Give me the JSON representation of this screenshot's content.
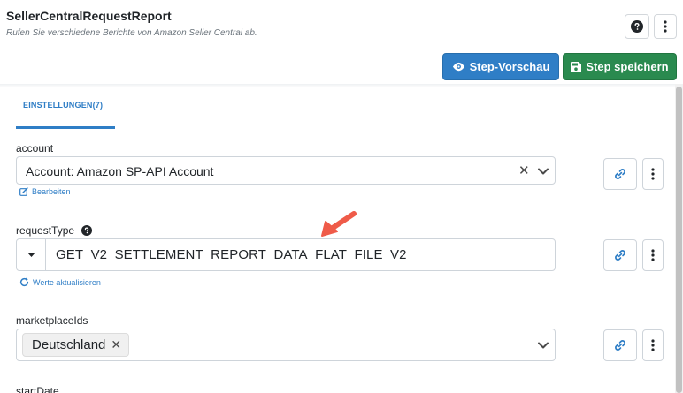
{
  "header": {
    "title": "SellerCentralRequestReport",
    "subtitle": "Rufen Sie verschiedene Berichte von Amazon Seller Central ab.",
    "preview_label": "Step-Vorschau",
    "save_label": "Step speichern",
    "preview_color": "#2f7ec6",
    "save_color": "#2a8a4f"
  },
  "tabs": [
    {
      "label": "EINSTELLUNGEN(7)",
      "active": true
    }
  ],
  "fields": {
    "account": {
      "label": "account",
      "value": "Account: Amazon SP-API Account",
      "link_label": "Bearbeiten"
    },
    "requestType": {
      "label": "requestType",
      "value": "GET_V2_SETTLEMENT_REPORT_DATA_FLAT_FILE_V2",
      "link_label": "Werte aktualisieren"
    },
    "marketplaceIds": {
      "label": "marketplaceIds",
      "chips": [
        "Deutschland"
      ]
    },
    "startDate": {
      "label": "startDate"
    }
  },
  "icons": {
    "help": "question-circle-icon",
    "menu": "vertical-ellipsis-icon",
    "preview": "eye-icon",
    "save": "floppy-disk-icon",
    "link": "link-icon",
    "edit": "edit-icon",
    "refresh": "refresh-icon",
    "annotation": "red-arrow-annotation"
  }
}
